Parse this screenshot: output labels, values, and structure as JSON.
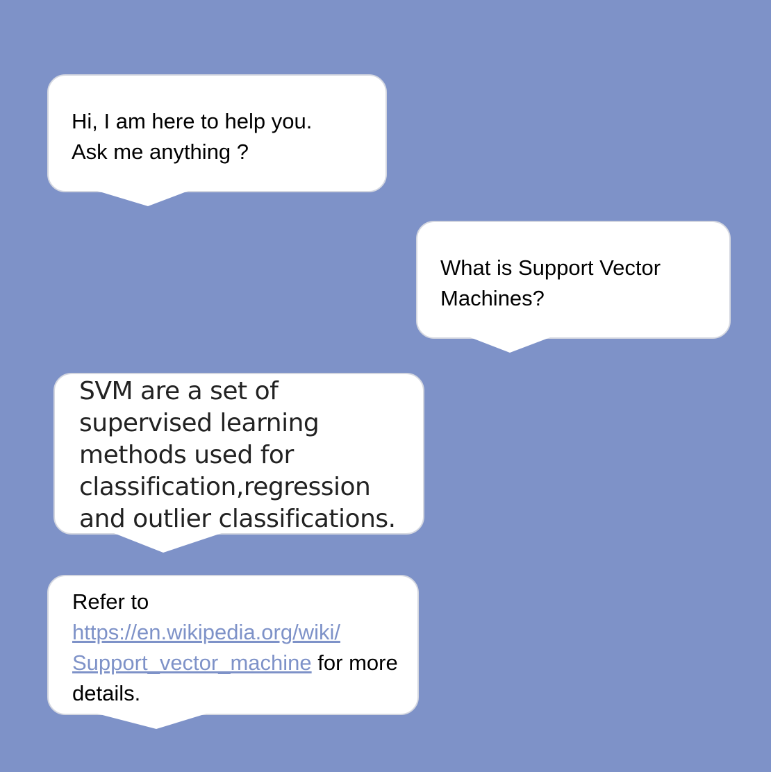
{
  "colors": {
    "background": "#7e92c8",
    "bubble": "#ffffff",
    "link": "#7e92c8"
  },
  "messages": [
    {
      "sender": "bot",
      "text": "Hi, I am here to help you.\nAsk me anything ?"
    },
    {
      "sender": "user",
      "text": "What is Support Vector\nMachines?"
    },
    {
      "sender": "bot",
      "text": "SVM are a set of\nsupervised learning\nmethods used for\nclassification,regression\nand outlier classifications."
    },
    {
      "sender": "bot",
      "prefix": "Refer to",
      "link": "https://en.wikipedia.org/wiki/Support_vector_machine",
      "link_line1": "https://en.wikipedia.org/wiki/",
      "link_line2": "Support_vector_machine",
      "suffix": "for more details."
    }
  ]
}
